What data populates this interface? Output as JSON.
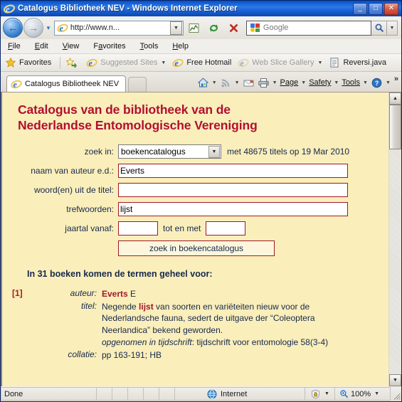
{
  "window": {
    "title": "Catalogus Bibliotheek NEV - Windows Internet Explorer",
    "minimize_label": "_",
    "maximize_label": "□",
    "close_label": "✕"
  },
  "toolbar": {
    "back_glyph": "←",
    "forward_glyph": "→",
    "history_caret": "▼",
    "address_value": "http://www.n...",
    "address_caret": "▼",
    "search_placeholder": "Google",
    "search_go_glyph": "⌕",
    "search_caret": "▼"
  },
  "menu": {
    "items": [
      {
        "label": "File",
        "accel": "F"
      },
      {
        "label": "Edit",
        "accel": "E"
      },
      {
        "label": "View",
        "accel": "V"
      },
      {
        "label": "Favorites",
        "accel": "a"
      },
      {
        "label": "Tools",
        "accel": "T"
      },
      {
        "label": "Help",
        "accel": "H"
      }
    ]
  },
  "favorites_bar": {
    "favorites_label": "Favorites",
    "items": [
      {
        "label": "Suggested Sites",
        "dim": true,
        "caret": "▼"
      },
      {
        "label": "Free Hotmail",
        "dim": false,
        "caret": ""
      },
      {
        "label": "Web Slice Gallery",
        "dim": true,
        "caret": "▼"
      },
      {
        "label": "Reversi.java",
        "dim": false,
        "caret": ""
      }
    ]
  },
  "tabs": {
    "active": "Catalogus Bibliotheek NEV"
  },
  "command_bar": {
    "items": [
      {
        "label": "",
        "icon": "home-icon",
        "caret": "▼"
      },
      {
        "label": "",
        "icon": "feeds-icon",
        "caret": "▼"
      },
      {
        "label": "",
        "icon": "mail-icon",
        "caret": ""
      },
      {
        "label": "",
        "icon": "print-icon",
        "caret": "▼"
      },
      {
        "label": "Page",
        "icon": "",
        "caret": "▼"
      },
      {
        "label": "Safety",
        "icon": "",
        "caret": "▼"
      },
      {
        "label": "Tools",
        "icon": "",
        "caret": "▼"
      },
      {
        "label": "",
        "icon": "help-icon",
        "caret": "▼"
      }
    ],
    "overflow": "»"
  },
  "page": {
    "heading_line1": "Catalogus van de bibliotheek van de",
    "heading_line2": "Nederlandse Entomologische Vereniging",
    "colors": {
      "background": "#faeeba",
      "heading": "#b01030",
      "text": "#16294d",
      "field_border": "#a01828"
    },
    "form": {
      "search_in_label": "zoek in:",
      "search_in_value": "boekencatalogus",
      "search_in_caret": "▼",
      "titles_count_text": "met 48675 titels op 19 Mar 2010",
      "author_label": "naam van auteur e.d.:",
      "author_value": "Everts",
      "title_words_label": "woord(en) uit de titel:",
      "title_words_value": "",
      "keywords_label": "trefwoorden:",
      "keywords_value": "lijst",
      "year_from_label": "jaartal vanaf:",
      "year_from_value": "",
      "year_to_label": "tot en met",
      "year_to_value": "",
      "submit_label": "zoek in boekencatalogus"
    },
    "results_heading": "In 31 boeken komen de termen geheel voor:",
    "results": [
      {
        "number": "[1]",
        "fields": [
          {
            "key": "auteur:",
            "value_pre": "",
            "value_bold": "Everts",
            "value_post": " E"
          },
          {
            "key": "titel:",
            "value_pre": "Negende ",
            "value_bold": "lijst",
            "value_post": " van soorten en variëteiten nieuw voor de Nederlandsche fauna, sedert de uitgave der “Coleoptera Neerlandica” bekend geworden."
          },
          {
            "key": "",
            "value_pre": "opgenomen in tijdschrift",
            "value_bold": "",
            "value_post": ": tijdschrift voor entomologie 58(3-4)",
            "italic_key": true
          },
          {
            "key": "collatie:",
            "value_pre": "pp 163-191; HB",
            "value_bold": "",
            "value_post": ""
          }
        ]
      }
    ]
  },
  "scrollbar": {
    "up_glyph": "▲",
    "down_glyph": "▼"
  },
  "status_bar": {
    "status": "Done",
    "zone": "Internet",
    "zoom": "100%",
    "zone_caret": "▼",
    "zoom_caret": "▼"
  }
}
